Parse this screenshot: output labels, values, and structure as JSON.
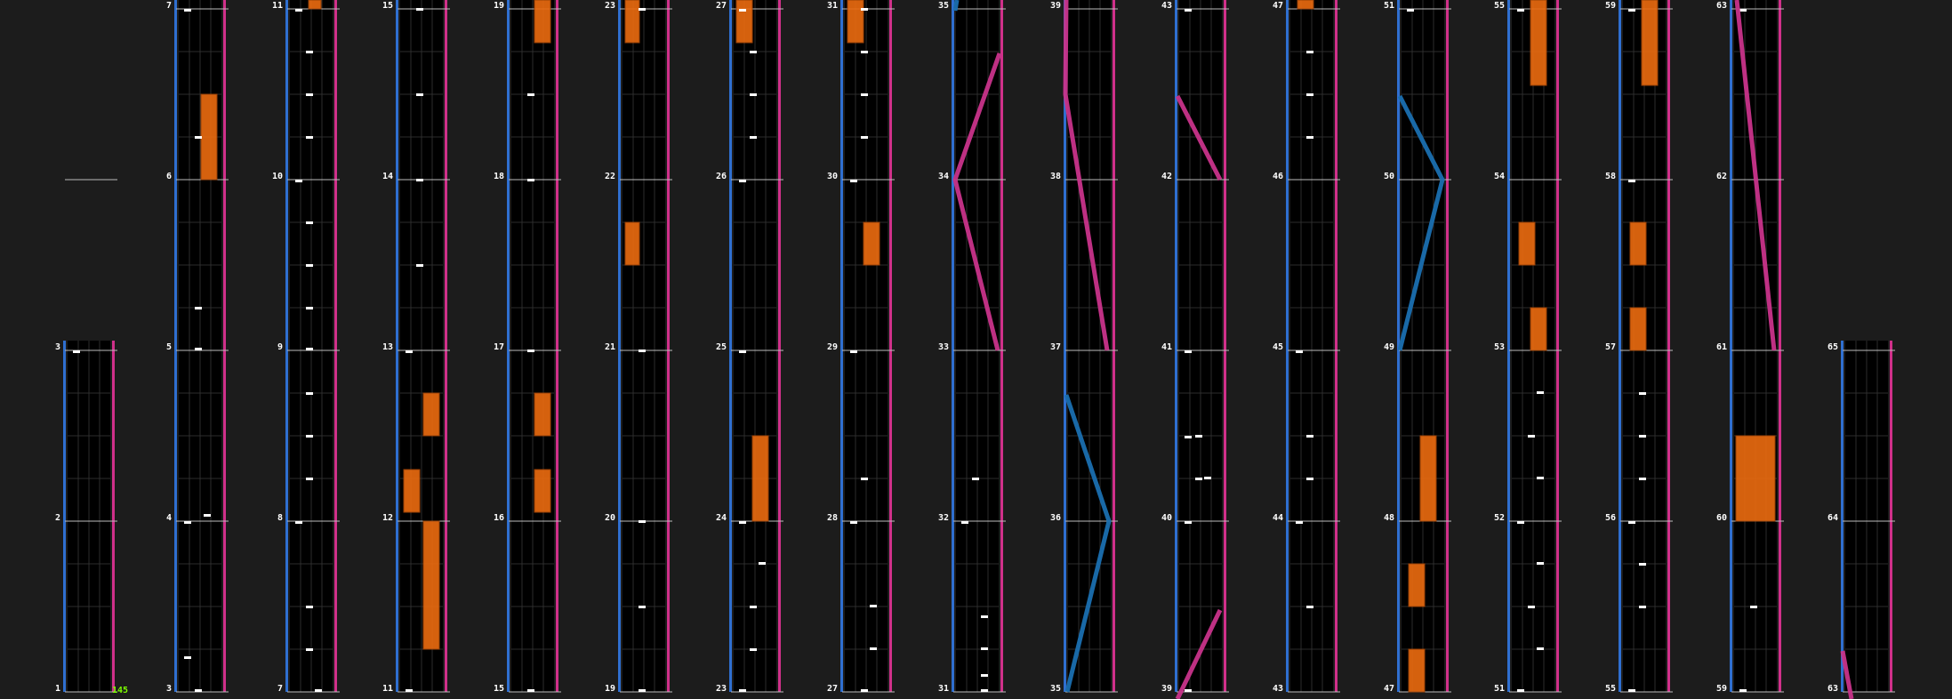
{
  "viewer": {
    "title": "",
    "combo_counter": "145"
  },
  "colors": {
    "background": "#1c1c1c",
    "lane": "#000000",
    "left_separator": "#2f6fd0",
    "right_separator": "#d0308a",
    "note": "#ffffff",
    "hold": "#e86a10",
    "slide_pink": "#c8338a",
    "slide_blue": "#1a6fb0",
    "counter": "#7cfc00"
  },
  "columns": [
    {
      "rows": [
        {
          "label": "1"
        },
        {
          "label": "2"
        },
        {
          "label": "3"
        }
      ]
    },
    {
      "rows": [
        {
          "label": "3"
        },
        {
          "label": "4"
        },
        {
          "label": "5"
        },
        {
          "label": "6"
        },
        {
          "label": "7"
        }
      ]
    },
    {
      "rows": [
        {
          "label": "7"
        },
        {
          "label": "8"
        },
        {
          "label": "9"
        },
        {
          "label": "10"
        },
        {
          "label": "11"
        }
      ]
    },
    {
      "rows": [
        {
          "label": "11"
        },
        {
          "label": "12"
        },
        {
          "label": "13"
        },
        {
          "label": "14"
        },
        {
          "label": "15"
        }
      ]
    },
    {
      "rows": [
        {
          "label": "15"
        },
        {
          "label": "16"
        },
        {
          "label": "17"
        },
        {
          "label": "18"
        },
        {
          "label": "19"
        }
      ]
    },
    {
      "rows": [
        {
          "label": "19"
        },
        {
          "label": "20"
        },
        {
          "label": "21"
        },
        {
          "label": "22"
        },
        {
          "label": "23"
        }
      ]
    },
    {
      "rows": [
        {
          "label": "23"
        },
        {
          "label": "24"
        },
        {
          "label": "25"
        },
        {
          "label": "26"
        },
        {
          "label": "27"
        }
      ]
    },
    {
      "rows": [
        {
          "label": "27"
        },
        {
          "label": "28"
        },
        {
          "label": "29"
        },
        {
          "label": "30"
        },
        {
          "label": "31"
        }
      ]
    },
    {
      "rows": [
        {
          "label": "31"
        },
        {
          "label": "32"
        },
        {
          "label": "33"
        },
        {
          "label": "34"
        },
        {
          "label": "35"
        }
      ]
    },
    {
      "rows": [
        {
          "label": "35"
        },
        {
          "label": "36"
        },
        {
          "label": "37"
        },
        {
          "label": "38"
        },
        {
          "label": "39"
        }
      ]
    },
    {
      "rows": [
        {
          "label": "39"
        },
        {
          "label": "40"
        },
        {
          "label": "41"
        },
        {
          "label": "42"
        },
        {
          "label": "43"
        }
      ]
    },
    {
      "rows": [
        {
          "label": "43"
        },
        {
          "label": "44"
        },
        {
          "label": "45"
        },
        {
          "label": "46"
        },
        {
          "label": "47"
        }
      ]
    },
    {
      "rows": [
        {
          "label": "47"
        },
        {
          "label": "48"
        },
        {
          "label": "49"
        },
        {
          "label": "50"
        },
        {
          "label": "51"
        }
      ]
    },
    {
      "rows": [
        {
          "label": "51"
        },
        {
          "label": "52"
        },
        {
          "label": "53"
        },
        {
          "label": "54"
        },
        {
          "label": "55"
        }
      ]
    },
    {
      "rows": [
        {
          "label": "55"
        },
        {
          "label": "56"
        },
        {
          "label": "57"
        },
        {
          "label": "58"
        },
        {
          "label": "59"
        }
      ]
    },
    {
      "rows": [
        {
          "label": "59"
        },
        {
          "label": "60"
        },
        {
          "label": "61"
        },
        {
          "label": "62"
        },
        {
          "label": "63"
        }
      ]
    },
    {
      "rows": [
        {
          "label": "63"
        },
        {
          "label": "64"
        },
        {
          "label": "65"
        }
      ]
    }
  ]
}
